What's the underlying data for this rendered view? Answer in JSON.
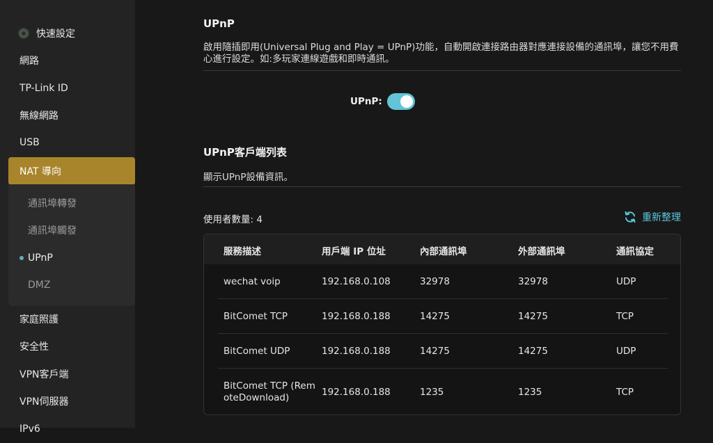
{
  "sidebar": {
    "items": [
      {
        "label": "快速設定"
      },
      {
        "label": "網路"
      },
      {
        "label": "TP-Link ID"
      },
      {
        "label": "無線網路"
      },
      {
        "label": "USB"
      },
      {
        "label": "NAT 導向"
      },
      {
        "label": "家庭照護"
      },
      {
        "label": "安全性"
      },
      {
        "label": "VPN客戶端"
      },
      {
        "label": "VPN伺服器"
      },
      {
        "label": "IPv6"
      }
    ],
    "nat_submenu": [
      {
        "label": "通訊埠轉發"
      },
      {
        "label": "通訊埠觸發"
      },
      {
        "label": "UPnP"
      },
      {
        "label": "DMZ"
      }
    ]
  },
  "upnp": {
    "title": "UPnP",
    "description": "啟用隨插即用(Universal Plug and Play = UPnP)功能，自動開啟連接路由器對應連接設備的通訊埠，讓您不用費心進行設定。如:多玩家連線遊戲和即時通訊。",
    "toggle_label": "UPnP:",
    "enabled": true
  },
  "client_list": {
    "title": "UPnP客戶端列表",
    "description": "顯示UPnP設備資訊。",
    "count_label": "使用者數量: 4",
    "refresh_label": "重新整理",
    "headers": [
      "服務描述",
      "用戶端 IP 位址",
      "內部通訊埠",
      "外部通訊埠",
      "通訊協定"
    ],
    "rows": [
      {
        "service": "wechat voip",
        "ip": "192.168.0.108",
        "internal": "32978",
        "external": "32978",
        "protocol": "UDP"
      },
      {
        "service": "BitComet TCP",
        "ip": "192.168.0.188",
        "internal": "14275",
        "external": "14275",
        "protocol": "TCP"
      },
      {
        "service": "BitComet UDP",
        "ip": "192.168.0.188",
        "internal": "14275",
        "external": "14275",
        "protocol": "UDP"
      },
      {
        "service": "BitComet TCP (RemoteDownload)",
        "service_line1": "BitComet TCP (Rem",
        "service_line2": "oteDownload)",
        "ip": "192.168.0.188",
        "internal": "1235",
        "external": "1235",
        "protocol": "TCP"
      }
    ]
  },
  "colors": {
    "accent": "#5cc7dc",
    "active_nav": "#a8852b",
    "toggle_on": "#62c4d6"
  }
}
